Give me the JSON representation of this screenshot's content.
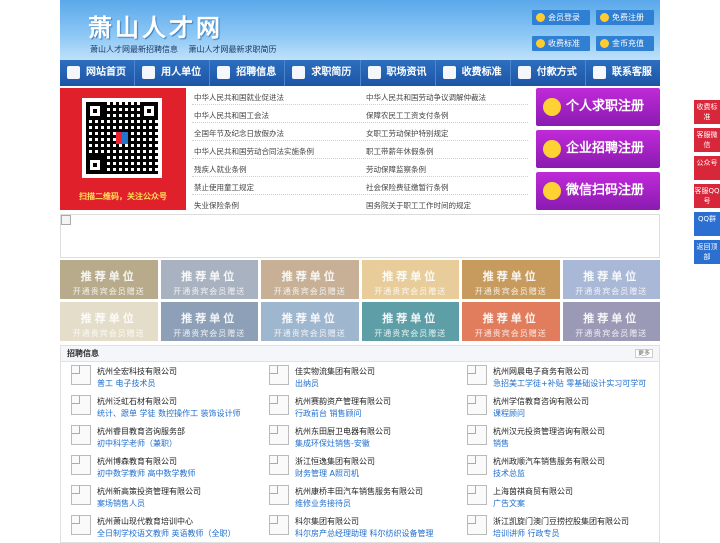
{
  "header": {
    "logo": "萧山人才网",
    "taglines": [
      "萧山人才网最新招聘信息",
      "萧山人才网最新求职简历"
    ],
    "buttons": [
      "会员登录",
      "免费注册",
      "收费标准",
      "金币充值"
    ]
  },
  "nav": [
    "网站首页",
    "用人单位",
    "招聘信息",
    "求职简历",
    "职场资讯",
    "收费标准",
    "付款方式",
    "联系客服"
  ],
  "qr": {
    "caption": "扫描二维码，关注公众号"
  },
  "laws": {
    "left": [
      "中华人民共和国就业促进法",
      "中华人民共和国工会法",
      "全国年节及纪念日放假办法",
      "中华人民共和国劳动合同法实施条例",
      "残疾人就业条例",
      "禁止使用童工规定",
      "失业保险条例"
    ],
    "right": [
      "中华人民共和国劳动争议调解仲裁法",
      "保障农民工工资支付条例",
      "女职工劳动保护特别规定",
      "职工带薪年休假条例",
      "劳动保障监察条例",
      "社会保险费征缴暂行条例",
      "国务院关于职工工作时间的规定"
    ]
  },
  "register": [
    "个人求职注册",
    "企业招聘注册",
    "微信扫码注册"
  ],
  "tiles": {
    "title": "推荐单位",
    "subtitle": "开通贵宾会员赠送",
    "colors": [
      "#b7ab8c",
      "#a9b2c0",
      "#c7b096",
      "#e8cc9a",
      "#c79a5e",
      "#a9b8d6",
      "#e4ddc9",
      "#8da0b8",
      "#9fb6cf",
      "#5e9fa7",
      "#e17d5c",
      "#9a99b6"
    ]
  },
  "jobs": {
    "title": "招聘信息",
    "more": "更多",
    "columns": [
      [
        {
          "company": "杭州全宏科技有限公司",
          "positions": "普工 电子技术员"
        },
        {
          "company": "杭州泛虹石材有限公司",
          "positions": "统计、跟单 学徒 数控操作工 装饰设计师"
        },
        {
          "company": "杭州睿目教育咨询服务部",
          "positions": "初中科学老师（兼职）"
        },
        {
          "company": "杭州博森教育有限公司",
          "positions": "初中数学教师 高中数学教师"
        },
        {
          "company": "杭州新高策投资管理有限公司",
          "positions": "案场销售人员"
        },
        {
          "company": "杭州萧山现代教育培训中心",
          "positions": "全日制学校语文教师 英语教师（全职）"
        }
      ],
      [
        {
          "company": "佳实物流集团有限公司",
          "positions": "出纳员"
        },
        {
          "company": "杭州赛韵资产管理有限公司",
          "positions": "行政前台 销售顾问"
        },
        {
          "company": "杭州东田厨卫电器有限公司",
          "positions": "集成环保灶销售-安徽"
        },
        {
          "company": "浙江恒逸集团有限公司",
          "positions": "财务管理 A照司机"
        },
        {
          "company": "杭州康桥丰田汽车销售服务有限公司",
          "positions": "维修业务接待员"
        },
        {
          "company": "科尔集团有限公司",
          "positions": "科尔房产总经理助理 科尔纺织设备管理"
        }
      ],
      [
        {
          "company": "杭州网晨电子商务有限公司",
          "positions": "急招美工学徒+补贴 零基础设计实习可学可"
        },
        {
          "company": "杭州学信教育咨询有限公司",
          "positions": "课程顾问"
        },
        {
          "company": "杭州汉元投资管理咨询有限公司",
          "positions": "销售"
        },
        {
          "company": "杭州政顺汽车销售服务有限公司",
          "positions": "技术总监"
        },
        {
          "company": "上海茵祺商贸有限公司",
          "positions": "广告文案"
        },
        {
          "company": "浙江凯旋门澳门豆捞控股集团有限公司",
          "positions": "培训讲师 行政专员"
        }
      ]
    ]
  },
  "side": [
    "收费标准",
    "客服微信",
    "公众号",
    "客服QQ号",
    "QQ群",
    "返回顶部"
  ]
}
